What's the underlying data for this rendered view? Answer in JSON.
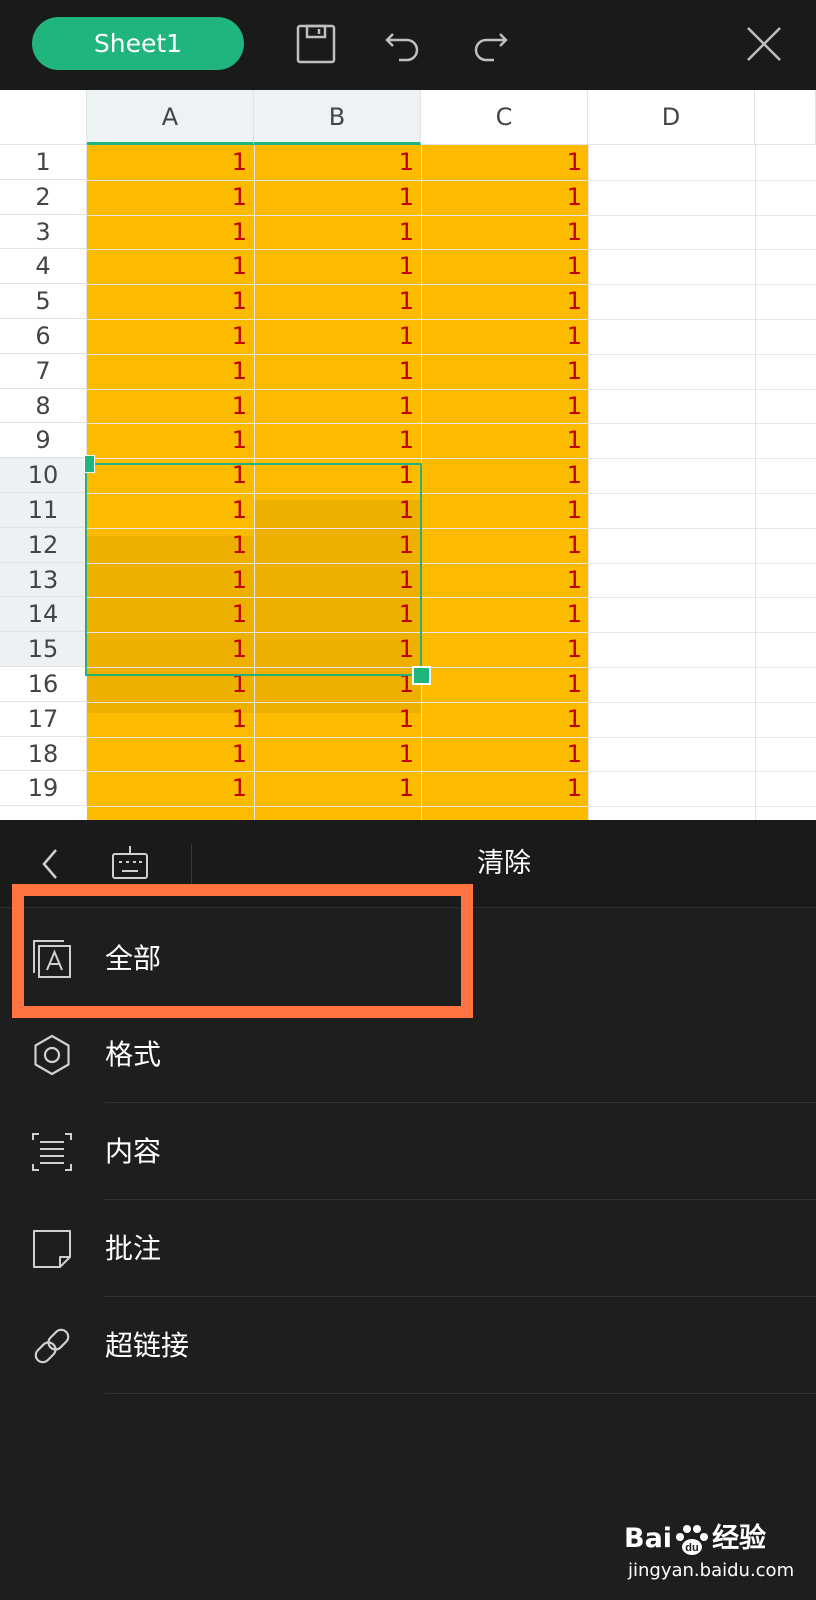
{
  "toolbar": {
    "sheet_tab": "Sheet1",
    "icons": [
      "save-icon",
      "undo-icon",
      "redo-icon",
      "close-icon"
    ]
  },
  "spreadsheet": {
    "columns": [
      "A",
      "B",
      "C",
      "D"
    ],
    "selected_columns": [
      "A",
      "B"
    ],
    "rows": [
      "1",
      "2",
      "3",
      "4",
      "5",
      "6",
      "7",
      "8",
      "9",
      "10",
      "11",
      "12",
      "13",
      "14",
      "15",
      "16",
      "17",
      "18",
      "19"
    ],
    "selected_rows": [
      "10",
      "11",
      "12",
      "13",
      "14",
      "15"
    ],
    "cell_value": "1",
    "fill_color": "#fdbb00",
    "value_color": "#c00000",
    "selection_color": "#1fb57c"
  },
  "panel": {
    "title": "清除",
    "items": [
      {
        "label": "全部",
        "icon": "clear-all-icon"
      },
      {
        "label": "格式",
        "icon": "gear-icon"
      },
      {
        "label": "内容",
        "icon": "content-icon"
      },
      {
        "label": "批注",
        "icon": "comment-icon"
      },
      {
        "label": "超链接",
        "icon": "link-icon"
      }
    ],
    "highlight_color": "#ff7441"
  },
  "watermark": {
    "brand_prefix": "Bai",
    "brand_suffix": "经验",
    "url": "jingyan.baidu.com"
  }
}
